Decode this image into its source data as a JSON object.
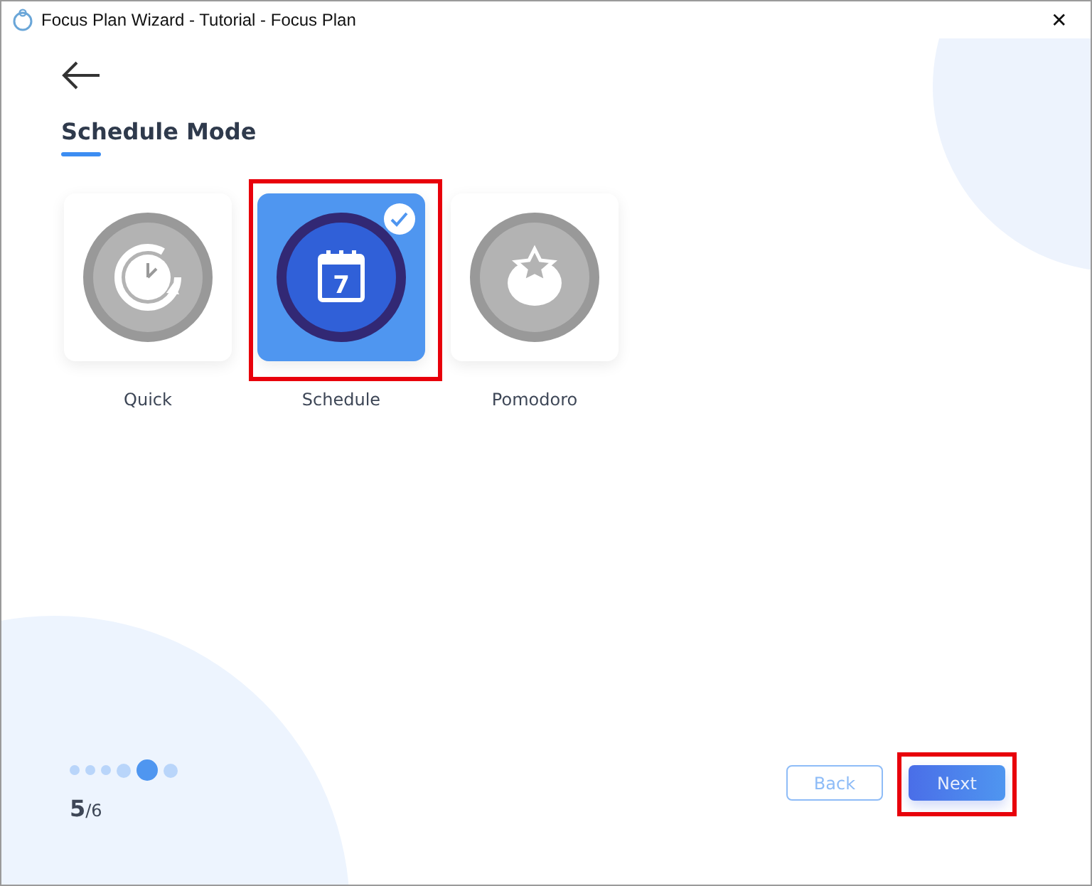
{
  "window": {
    "title": "Focus Plan Wizard - Tutorial - Focus Plan",
    "close": "✕"
  },
  "heading": "Schedule Mode",
  "modes": [
    {
      "kind": "clock",
      "label": "Quick",
      "selected": false,
      "highlighted": false
    },
    {
      "kind": "calendar",
      "label": "Schedule",
      "selected": true,
      "highlighted": true,
      "day": "7"
    },
    {
      "kind": "tomato",
      "label": "Pomodoro",
      "selected": false,
      "highlighted": false
    }
  ],
  "steps": [
    {
      "selected": false
    },
    {
      "selected": false
    },
    {
      "selected": false
    },
    {
      "selected": false
    },
    {
      "selected": true
    },
    {
      "selected": false
    }
  ],
  "progress": {
    "current": "5",
    "total": "/6"
  },
  "buttons": [
    {
      "kind": "back",
      "label": "Back",
      "highlighted": false
    },
    {
      "kind": "next",
      "label": "Next",
      "highlighted": true
    }
  ]
}
